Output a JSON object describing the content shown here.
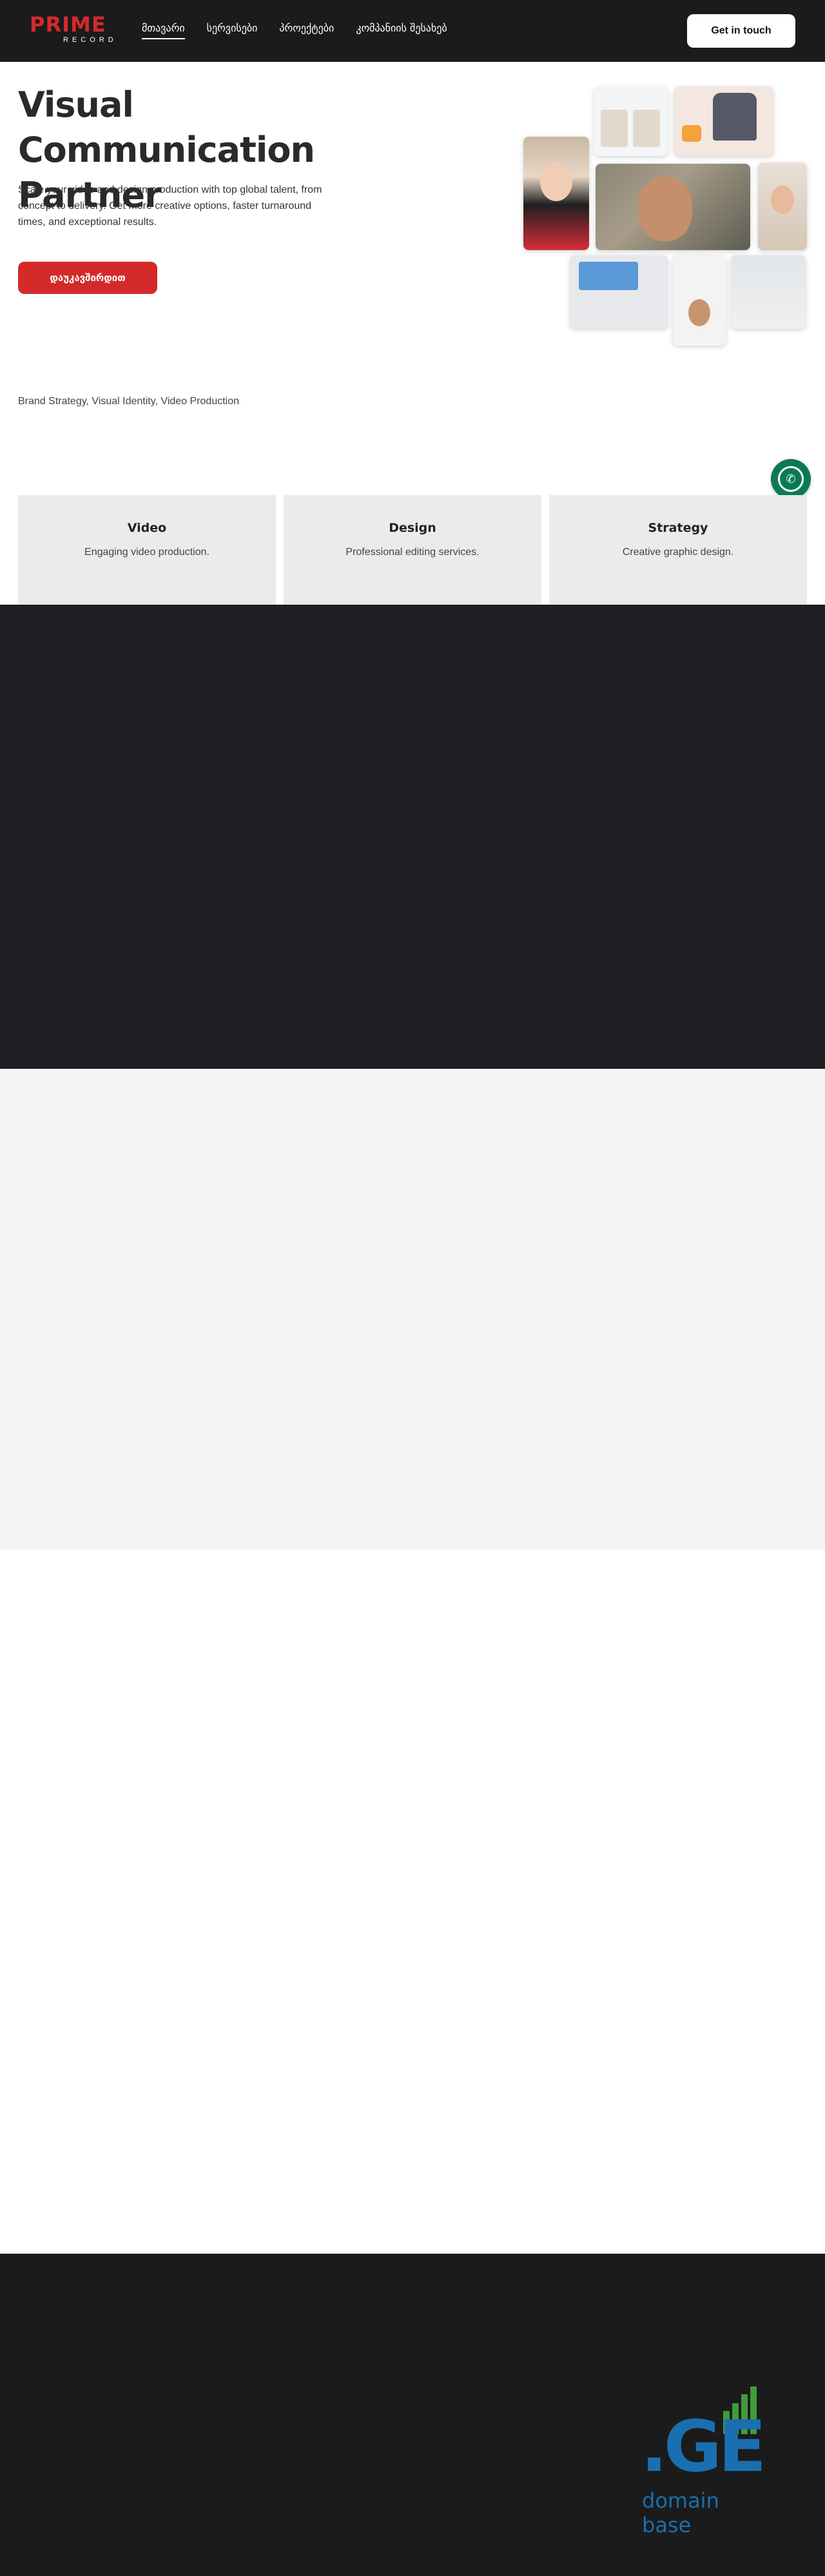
{
  "header": {
    "logo_top": "PRIME",
    "logo_bottom": "RECORD",
    "nav": [
      {
        "label": "მთავარი",
        "active": true
      },
      {
        "label": "სერვისები",
        "active": false
      },
      {
        "label": "პროექტები",
        "active": false
      },
      {
        "label": "კომპანიის შესახებ",
        "active": false
      }
    ],
    "cta_label": "Get in touch"
  },
  "hero": {
    "title": "Visual Communication Partner",
    "subtitle": "Scale your video and design production with top global talent, from concept to delivery. Get more creative options, faster turnaround times, and exceptional results.",
    "button_label": "დაუკავშირდით",
    "services_line": "Brand Strategy, Visual Identity, Video Production"
  },
  "cards": [
    {
      "title": "Video",
      "description": "Engaging video production."
    },
    {
      "title": "Design",
      "description": "Professional editing services."
    },
    {
      "title": "Strategy",
      "description": "Creative graphic design."
    }
  ],
  "footer": {
    "logo_text": ".GE",
    "logo_sub": "domain base"
  },
  "colors": {
    "brand_red": "#d42a2a",
    "header_bg": "#1b1b1b",
    "whatsapp_green": "#0b7a54",
    "ge_blue": "#1a6fb0",
    "ge_green": "#3f9c3a"
  }
}
